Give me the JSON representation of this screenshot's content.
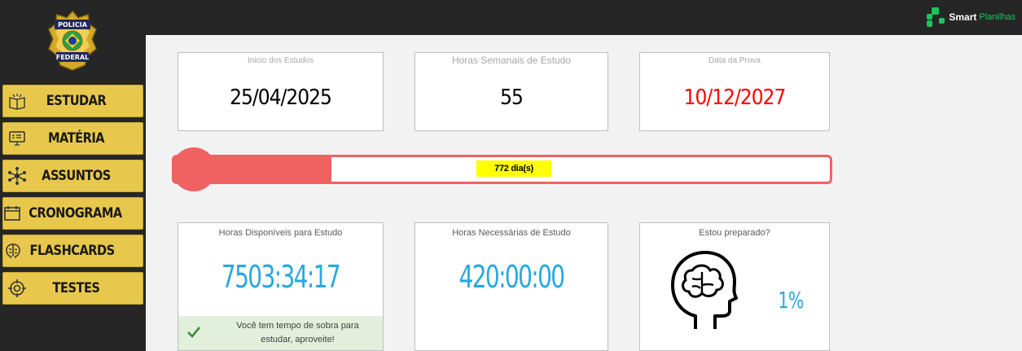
{
  "brand": {
    "name_bold": "Smart",
    "name_light": "Planilhas"
  },
  "logo": {
    "line1": "POLICIA",
    "line2": "FEDERAL"
  },
  "nav": [
    {
      "label": "ESTUDAR",
      "icon": "open-book-icon"
    },
    {
      "label": "MATÉRIA",
      "icon": "monitor-icon"
    },
    {
      "label": "ASSUNTOS",
      "icon": "network-icon"
    },
    {
      "label": "CRONOGRAMA",
      "icon": "calendar-icon"
    },
    {
      "label": "FLASHCARDS",
      "icon": "brain-icon"
    },
    {
      "label": "TESTES",
      "icon": "target-icon"
    }
  ],
  "cards": {
    "inicio": {
      "caption": "Inicio dos Estudos",
      "value": "25/04/2025"
    },
    "horas_semanais": {
      "caption": "Horas Semanais de Estudo",
      "value": "55"
    },
    "data_prova": {
      "caption": "Data da Prova",
      "value": "10/12/2027"
    }
  },
  "progress": {
    "label": "772 dia(s)",
    "fraction": 0.24
  },
  "stats": {
    "disponiveis": {
      "caption": "Horas Disponíveis para Estudo",
      "value": "7503:34:17",
      "note": "Você tem tempo de sobra para estudar, aproveite!"
    },
    "necessarias": {
      "caption": "Horas Necessárias de Estudo",
      "value": "420:00:00"
    },
    "preparado": {
      "caption": "Estou preparado?",
      "value": "1%"
    }
  },
  "colors": {
    "accent_red": "#f06262",
    "value_blue": "#29a8e0",
    "nav_yellow": "#e8c84c",
    "date_red": "#ff0000"
  }
}
